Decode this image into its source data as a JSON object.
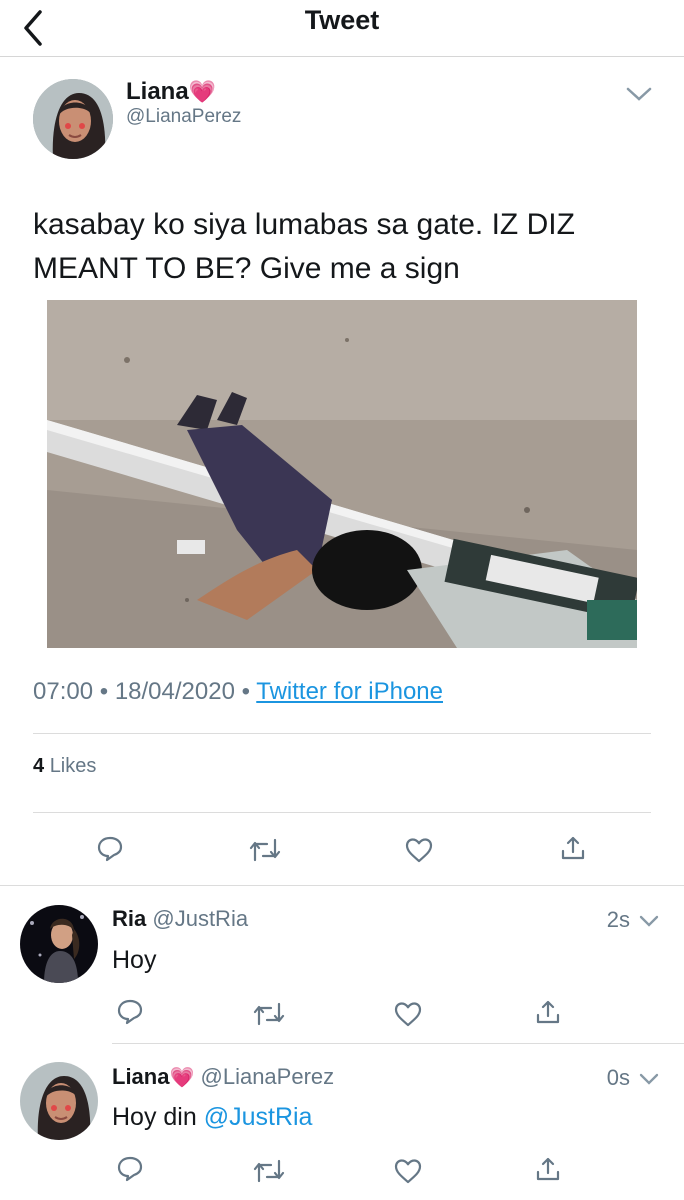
{
  "header": {
    "title": "Tweet"
  },
  "tweet": {
    "display_name": "Liana",
    "handle": "@LianaPerez",
    "text": "kasabay ko siya lumabas sa gate. IZ DIZ MEANT TO BE? Give me a sign",
    "time": "07:00",
    "date": "18/04/2020",
    "sep": "•",
    "source": "Twitter for iPhone",
    "likes_count": "4",
    "likes_label": "Likes",
    "emoji": "💗"
  },
  "replies": [
    {
      "display_name": "Ria",
      "handle": "@JustRia",
      "time": "2s",
      "text": "Hoy"
    },
    {
      "display_name": "Liana",
      "emoji": "💗",
      "handle": "@LianaPerez",
      "time": "0s",
      "text": "Hoy din",
      "mention": "@JustRia"
    }
  ],
  "colors": {
    "accent": "#1b95e0",
    "muted": "#657786",
    "text": "#14171a"
  },
  "icons": [
    "back-chevron-icon",
    "caret-down-icon",
    "reply-icon",
    "retweet-icon",
    "like-icon",
    "share-icon"
  ]
}
